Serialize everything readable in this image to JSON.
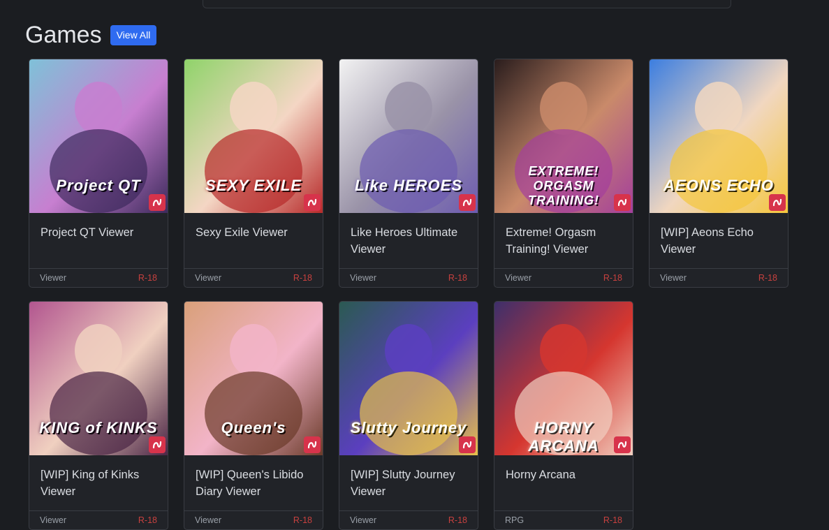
{
  "section": {
    "title": "Games",
    "view_all": "View All"
  },
  "cards": [
    {
      "title": "Project QT Viewer",
      "type": "Viewer",
      "rating": "R-18",
      "art_text": "Project QT",
      "colors": [
        "#7fc1d8",
        "#c77fd0",
        "#3d2a5c"
      ]
    },
    {
      "title": "Sexy Exile Viewer",
      "type": "Viewer",
      "rating": "R-18",
      "art_text": "SEXY EXILE",
      "colors": [
        "#8fd36a",
        "#f4d6c4",
        "#b72a2a"
      ]
    },
    {
      "title": "Like Heroes Ultimate Viewer",
      "type": "Viewer",
      "rating": "R-18",
      "art_text": "Like HEROES",
      "colors": [
        "#f2f2f2",
        "#9a93a8",
        "#6c5bb0"
      ]
    },
    {
      "title": "Extreme! Orgasm Training! Viewer",
      "type": "Viewer",
      "rating": "R-18",
      "art_text": "EXTREME! ORGASM TRAINING!",
      "colors": [
        "#2a1d1d",
        "#c98a6a",
        "#a43f9c"
      ]
    },
    {
      "title": "[WIP] Aeons Echo Viewer",
      "type": "Viewer",
      "rating": "R-18",
      "art_text": "AEONS ECHO",
      "colors": [
        "#3c7ee0",
        "#f1d7c0",
        "#f4c63c"
      ]
    },
    {
      "title": "[WIP] King of Kinks Viewer",
      "type": "Viewer",
      "rating": "R-18",
      "art_text": "KING of KINKS",
      "colors": [
        "#b2568f",
        "#f0d0c0",
        "#4a2545"
      ]
    },
    {
      "title": "[WIP] Queen's Libido Diary Viewer",
      "type": "Viewer",
      "rating": "R-18",
      "art_text": "Queen's",
      "colors": [
        "#d9a07a",
        "#f2b4c8",
        "#6b3b2a"
      ]
    },
    {
      "title": "[WIP] Slutty Journey Viewer",
      "type": "Viewer",
      "rating": "R-18",
      "art_text": "Slutty Journey",
      "colors": [
        "#2b5a52",
        "#5b3fbf",
        "#e7c04a"
      ]
    },
    {
      "title": "Horny Arcana",
      "type": "RPG",
      "rating": "R-18",
      "art_text": "HORNY ARCANA",
      "colors": [
        "#3e2f6b",
        "#d5362f",
        "#f1cfc0"
      ]
    }
  ]
}
